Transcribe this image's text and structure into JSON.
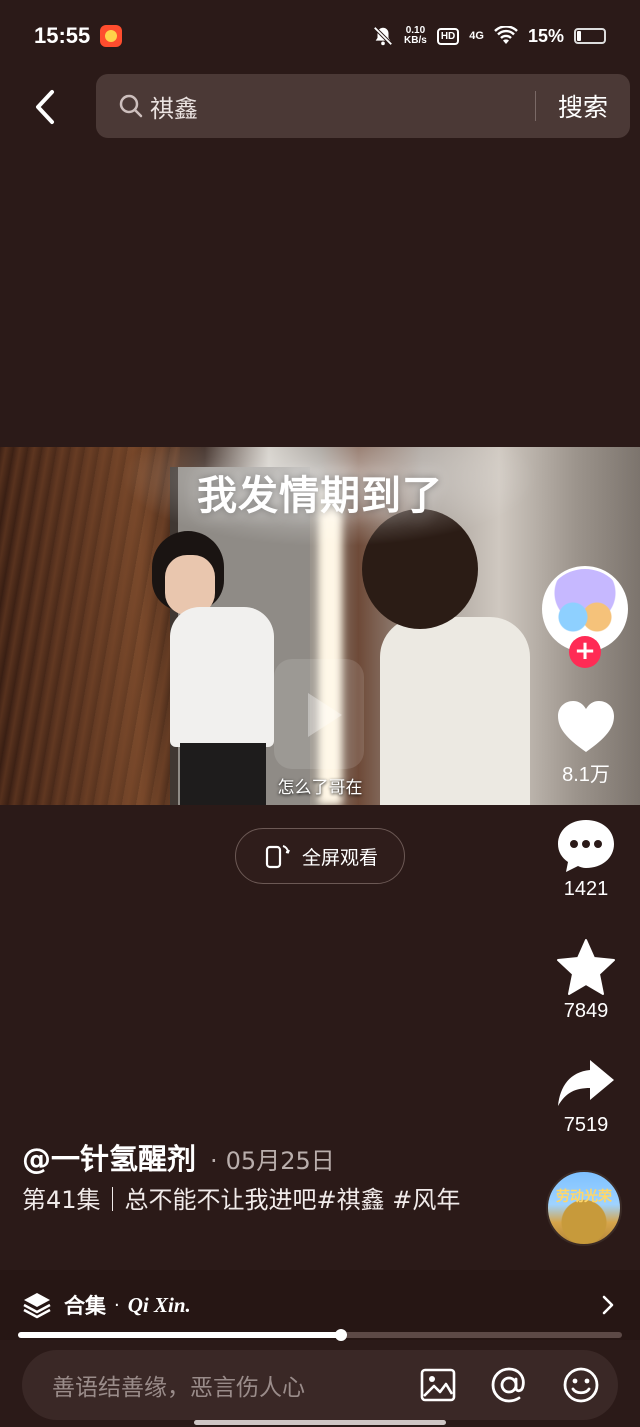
{
  "status_bar": {
    "time": "15:55",
    "net_speed_value": "0.10",
    "net_speed_unit": "KB/s",
    "hd_label": "HD",
    "network": "4G",
    "battery": "15%"
  },
  "search": {
    "query": "祺鑫",
    "submit_label": "搜索"
  },
  "video": {
    "caption": "我发情期到了",
    "subtitle": "怎么了哥在",
    "fullscreen_label": "全屏观看"
  },
  "actions": {
    "likes": "8.1万",
    "comments": "1421",
    "favorites": "7849",
    "shares": "7519"
  },
  "post": {
    "author": "@一针氢醒剂",
    "date_separator": "·",
    "date": "05月25日",
    "description": "第41集｜总不能不让我进吧#祺鑫 #风年"
  },
  "music": {
    "disc_text": "劳动光荣"
  },
  "collection": {
    "label": "合集",
    "dot": "·",
    "name": "Qi Xin."
  },
  "progress": {
    "fraction": 0.535
  },
  "comment": {
    "placeholder": "善语结善缘，恶言伤人心"
  },
  "colors": {
    "background": "#2b1a18",
    "accent": "#ff2b55"
  }
}
